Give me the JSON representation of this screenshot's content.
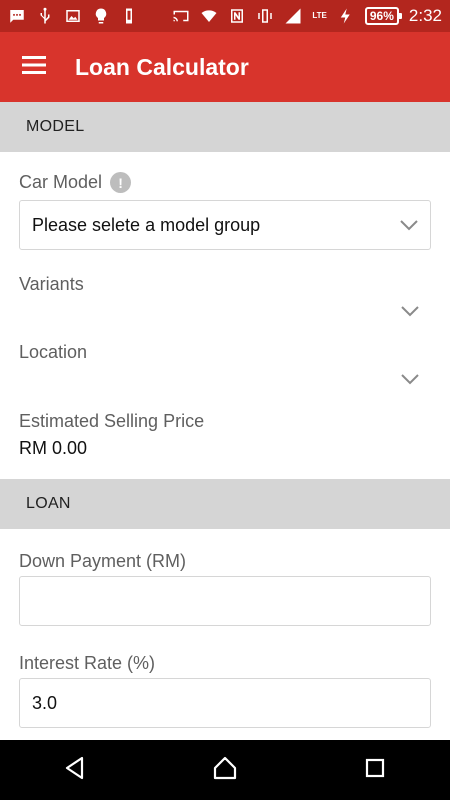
{
  "status_bar": {
    "battery": "96%",
    "time": "2:32",
    "network": "LTE"
  },
  "app_bar": {
    "title": "Loan Calculator",
    "menu_icon": "hamburger-menu-icon"
  },
  "sections": {
    "model": {
      "header": "MODEL",
      "car_model": {
        "label": "Car Model",
        "info_icon": "!",
        "selected": "Please selete a model group"
      },
      "variants": {
        "label": "Variants",
        "selected": ""
      },
      "location": {
        "label": "Location",
        "selected": ""
      },
      "price": {
        "label": "Estimated Selling Price",
        "value": "RM 0.00"
      }
    },
    "loan": {
      "header": "LOAN",
      "down_payment": {
        "label": "Down Payment (RM)",
        "value": ""
      },
      "interest_rate": {
        "label": "Interest Rate (%)",
        "value": "3.0"
      }
    }
  },
  "nav_bar": {
    "back": "back-icon",
    "home": "home-icon",
    "recents": "recents-icon"
  },
  "colors": {
    "status_bar": "#b3261e",
    "app_bar": "#d8342c",
    "section_header": "#d5d5d5"
  }
}
